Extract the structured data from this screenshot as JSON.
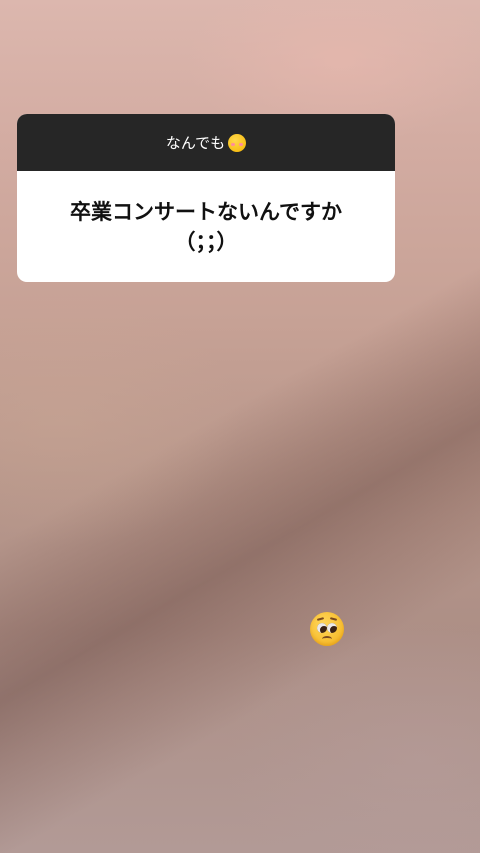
{
  "question_sticker": {
    "header_text": "なんでも",
    "header_emoji_icon": "kissing-face-icon",
    "question_line1": "卒業コンサートないんですか",
    "question_line2": "（；；）"
  },
  "reaction_sticker": {
    "icon": "pleading-face-icon"
  },
  "colors": {
    "header_background": "#262626",
    "card_background": "#ffffff",
    "text_dark": "#111111"
  }
}
